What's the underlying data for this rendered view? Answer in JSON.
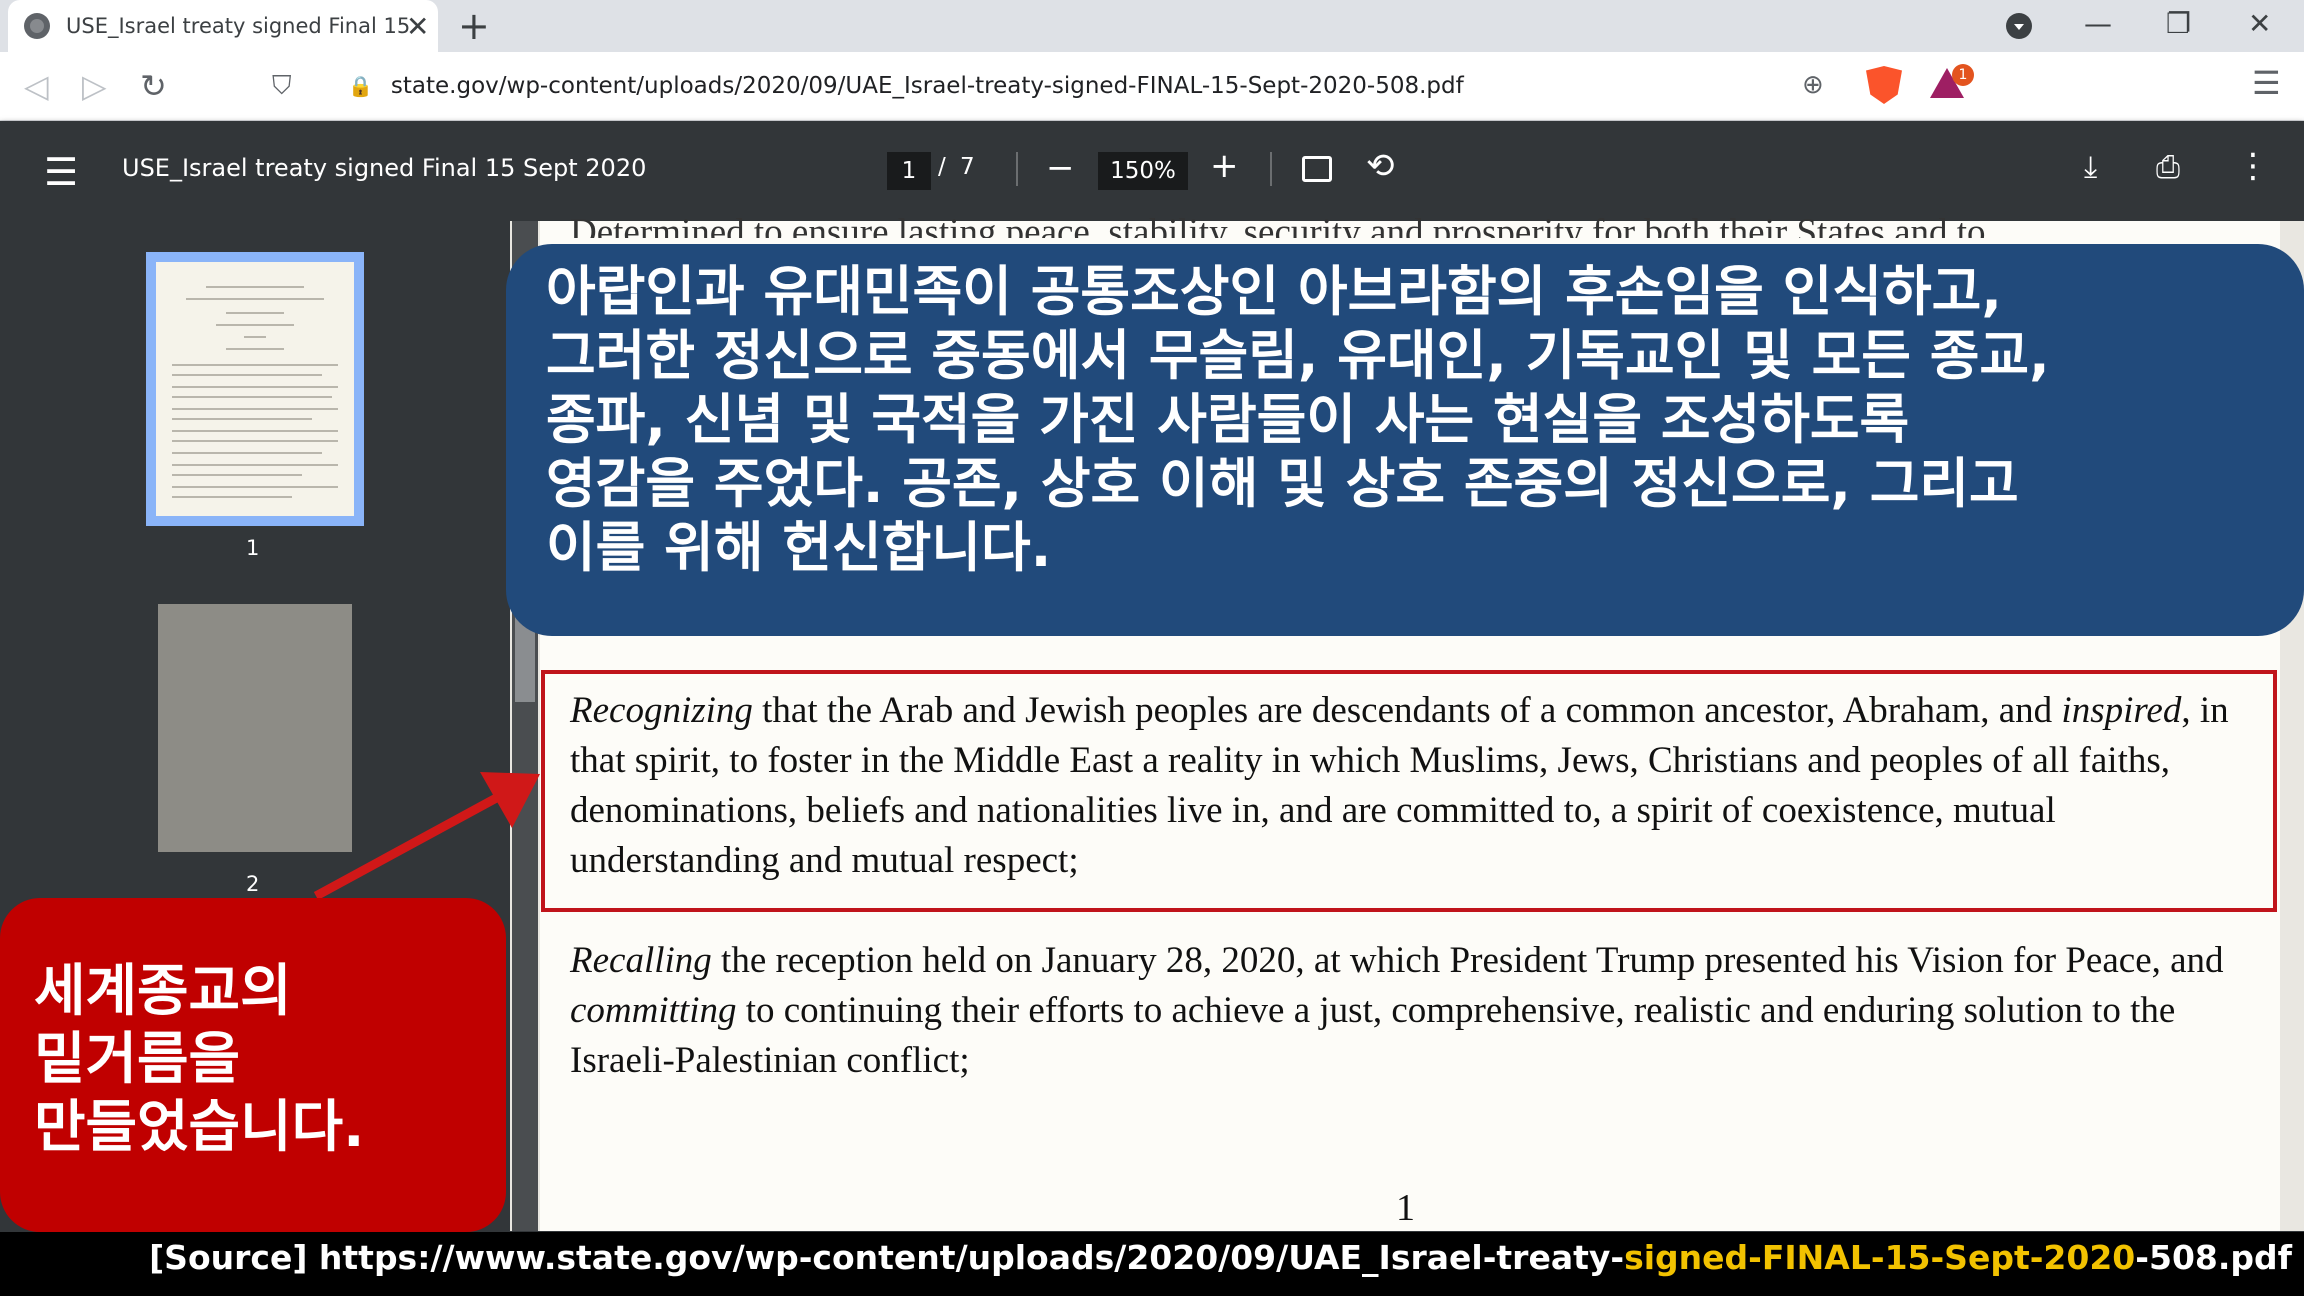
{
  "browser": {
    "tab_title": "USE_Israel treaty signed Final 15",
    "tab_close": "✕",
    "new_tab": "+",
    "url": "state.gov/wp-content/uploads/2020/09/UAE_Israel-treaty-signed-FINAL-15-Sept-2020-508.pdf",
    "bat_badge": "1",
    "window_controls": {
      "minimize": "—",
      "restore": "❐",
      "close": "✕"
    },
    "nav": {
      "back": "◁",
      "forward": "▷",
      "reload": "↻",
      "bookmark": "⛉",
      "lock": "🔒",
      "zoom": "⊕",
      "menu": "☰"
    }
  },
  "pdf_toolbar": {
    "menu_glyph": "☰",
    "doc_title": "USE_Israel treaty signed Final 15 Sept 2020",
    "current_page": "1",
    "page_sep": "/",
    "total_pages": "7",
    "zoom_out": "−",
    "zoom": "150%",
    "zoom_in": "+",
    "rotate": "⟲",
    "download": "⤓",
    "print": "⎙",
    "more": "⋮"
  },
  "sidebar": {
    "thumbnails": [
      {
        "label": "1"
      },
      {
        "label": "2"
      }
    ]
  },
  "document": {
    "cut_line": "Determined to ensure lasting peace, stability, security and prosperity for both their States and to",
    "para1": {
      "lead": "Recognizing",
      "t1": " that the Arab and Jewish peoples are descendants of a common ancestor, Abraham, and ",
      "em": "inspired",
      "t2": ", in that spirit, to foster in the Middle East a reality in which Muslims, Jews, Christians and peoples of all faiths, denominations, beliefs and nationalities live in, and are committed to, a spirit of coexistence, mutual understanding and mutual respect;"
    },
    "para2": {
      "lead": "Recalling",
      "t1": " the reception held on January 28, 2020, at which President Trump presented his Vision for Peace, and ",
      "em": "committing",
      "t2": " to continuing their efforts to achieve a just, comprehensive, realistic and enduring solution to the Israeli-Palestinian conflict;"
    },
    "page_number": "1"
  },
  "overlay": {
    "blue_lines": [
      "아랍인과 유대민족이 공통조상인 아브라함의 후손임을 인식하고,",
      "그러한 정신으로 중동에서 무슬림, 유대인, 기독교인 및 모든 종교,",
      "종파, 신념 및 국적을 가진 사람들이 사는 현실을 조성하도록",
      "영감을 주었다. 공존, 상호 이해 및 상호 존중의 정신으로, 그리고",
      "이를 위해 헌신합니다."
    ],
    "red_lines": [
      "세계종교의",
      "밑거름을",
      "만들었습니다."
    ],
    "blue_color": "#214a7b",
    "red_color": "#c00000"
  },
  "source": {
    "prefix": "[Source]  https://www.state.gov/wp-content/uploads/2020/09/UAE_Israel-treaty-",
    "highlight": "signed-FINAL-15-Sept-2020",
    "suffix": "-508.pdf",
    "highlight_color": "#f2c200"
  }
}
